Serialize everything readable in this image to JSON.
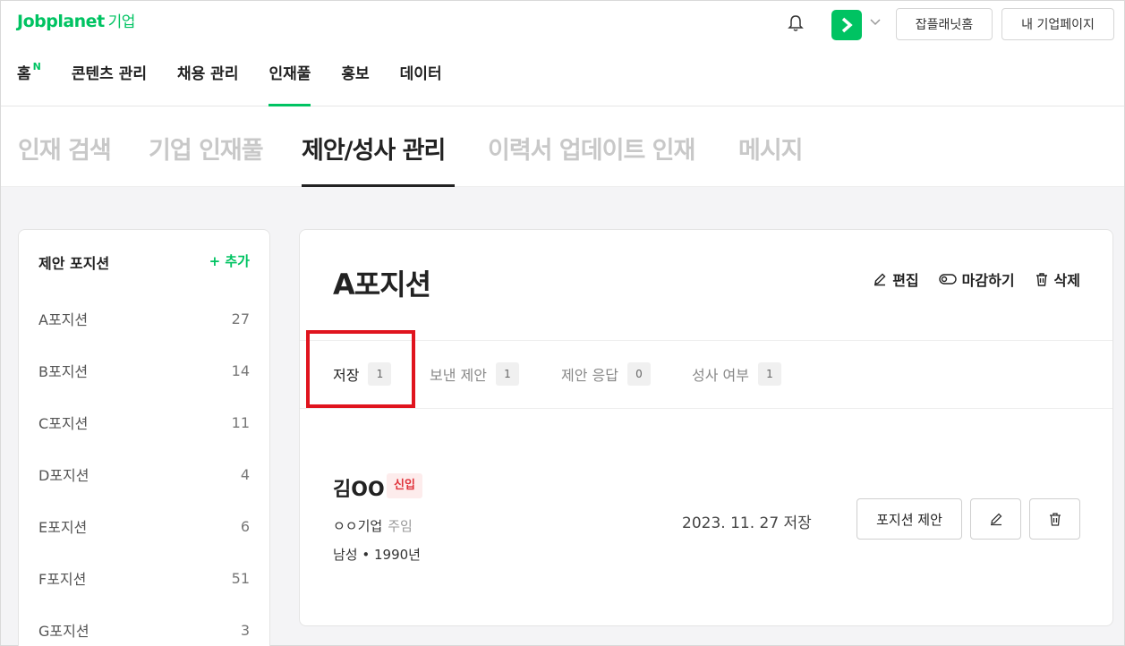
{
  "header": {
    "logo": "Jobplanet",
    "logo_sub": "기업",
    "home_button": "잡플래닛홈",
    "mypage_button": "내 기업페이지",
    "colors": {
      "brand": "#00c362",
      "highlight": "#e0141e"
    }
  },
  "main_nav": {
    "items": [
      {
        "label": "홈",
        "badge": "N"
      },
      {
        "label": "콘텐츠 관리"
      },
      {
        "label": "채용 관리"
      },
      {
        "label": "인재풀",
        "active": true
      },
      {
        "label": "홍보"
      },
      {
        "label": "데이터"
      }
    ]
  },
  "sub_tabs": [
    {
      "label": "인재 검색"
    },
    {
      "label": "기업 인재풀"
    },
    {
      "label": "제안/성사 관리",
      "active": true
    },
    {
      "label": "이력서 업데이트 인재"
    },
    {
      "label": "메시지"
    }
  ],
  "sidebar": {
    "title": "제안 포지션",
    "add_label": "+ 추가",
    "positions": [
      {
        "label": "A포지션",
        "count": "27"
      },
      {
        "label": "B포지션",
        "count": "14"
      },
      {
        "label": "C포지션",
        "count": "11"
      },
      {
        "label": "D포지션",
        "count": "4"
      },
      {
        "label": "E포지션",
        "count": "6"
      },
      {
        "label": "F포지션",
        "count": "51"
      },
      {
        "label": "G포지션",
        "count": "3"
      }
    ]
  },
  "panel": {
    "title": "A포지션",
    "actions": {
      "edit": "편집",
      "close": "마감하기",
      "delete": "삭제"
    },
    "tabs": [
      {
        "label": "저장",
        "count": "1",
        "active": true
      },
      {
        "label": "보낸 제안",
        "count": "1"
      },
      {
        "label": "제안 응답",
        "count": "0"
      },
      {
        "label": "성사 여부",
        "count": "1"
      }
    ],
    "candidate": {
      "name": "김OO",
      "tag": "신입",
      "company": "ㅇㅇ기업",
      "role": "주임",
      "info": "남성 • 1990년",
      "saved_date": "2023. 11. 27 저장",
      "propose_button": "포지션 제안"
    }
  }
}
